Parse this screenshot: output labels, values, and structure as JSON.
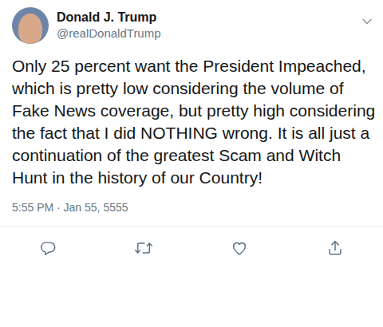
{
  "tweet": {
    "author": {
      "name": "Donald J. Trump",
      "handle": "@realDonaldTrump"
    },
    "text": "Only 25 percent want the President Impeached, which is pretty low considering the volume of Fake News coverage, but pretty high considering the fact that I did NOTHING wrong. It is all just a continuation of the greatest Scam and Witch Hunt in the history of our Country!",
    "timestamp": "5:55 PM · Jan 55, 5555"
  }
}
